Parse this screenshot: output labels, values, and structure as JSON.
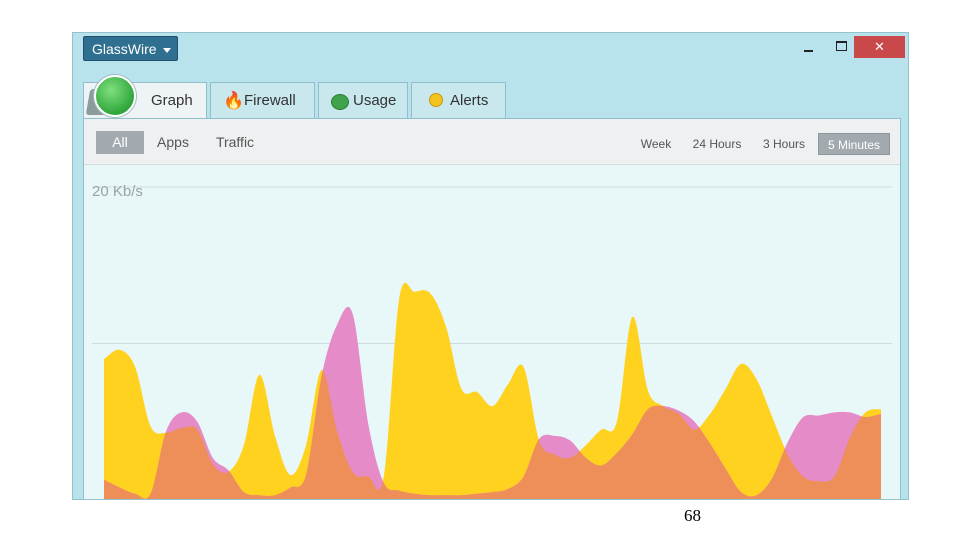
{
  "window": {
    "app_menu_label": "GlassWire",
    "close_glyph": "✕"
  },
  "tabs": [
    {
      "label": "Graph",
      "icon": "glasswire-logo-icon",
      "active": true
    },
    {
      "label": "Firewall",
      "icon": "flame-icon"
    },
    {
      "label": "Usage",
      "icon": "pie-icon"
    },
    {
      "label": "Alerts",
      "icon": "bulb-icon"
    }
  ],
  "filters": [
    "All",
    "Apps",
    "Traffic"
  ],
  "active_filter": "All",
  "ranges": [
    "Week",
    "24 Hours",
    "3 Hours",
    "5 Minutes"
  ],
  "active_range": "5 Minutes",
  "graph": {
    "scale_label": "20 Kb/s"
  },
  "colors": {
    "incoming": "#ffd21f",
    "outgoing": "#e48bc8",
    "overlap": "#ee8f5a",
    "background": "#e8f7f8"
  },
  "chart_data": {
    "type": "area",
    "ylabel": "20 Kb/s",
    "ylim": [
      0,
      20
    ],
    "x": [
      0,
      2,
      4,
      6,
      8,
      10,
      12,
      14,
      16,
      18,
      20,
      22,
      24,
      26,
      28,
      30,
      32,
      34,
      36,
      38,
      40,
      42,
      44,
      46,
      48,
      50,
      52,
      54,
      56,
      58,
      60,
      62,
      64,
      66,
      68,
      70,
      72,
      74,
      76,
      78,
      80,
      82,
      84,
      86,
      88,
      90,
      92,
      94,
      96,
      98,
      100
    ],
    "series": [
      {
        "values": [
          9.0,
          9.6,
          8.5,
          4.7,
          4.3,
          4.6,
          4.5,
          2.3,
          1.8,
          3.5,
          8.0,
          4.1,
          1.6,
          3.5,
          8.3,
          4.4,
          1.8,
          1.5,
          1.5,
          12.9,
          13.3,
          13.2,
          11.1,
          7.1,
          6.9,
          6.0,
          7.4,
          8.5,
          3.8,
          2.9,
          2.7,
          3.5,
          4.5,
          5.0,
          11.7,
          7.0,
          6.0,
          5.5,
          4.5,
          5.5,
          7.1,
          8.7,
          7.7,
          5.3,
          2.9,
          1.5,
          1.2,
          1.5,
          4.0,
          5.6,
          5.8
        ]
      },
      {
        "values": [
          1.3,
          0.8,
          0.4,
          0.4,
          4.4,
          5.6,
          5.0,
          2.7,
          1.9,
          0.5,
          0.3,
          0.3,
          0.8,
          1.6,
          7.9,
          11.2,
          11.9,
          4.9,
          1.1,
          0.6,
          0.4,
          0.3,
          0.3,
          0.3,
          0.4,
          0.5,
          0.7,
          1.5,
          3.9,
          4.1,
          3.8,
          2.7,
          2.2,
          3.0,
          4.2,
          5.8,
          6.0,
          5.7,
          5.0,
          3.6,
          2.0,
          0.5,
          0.3,
          1.4,
          3.7,
          5.3,
          5.4,
          5.6,
          5.6,
          5.3,
          5.5
        ]
      }
    ]
  },
  "footer": {
    "page_number": "68"
  }
}
